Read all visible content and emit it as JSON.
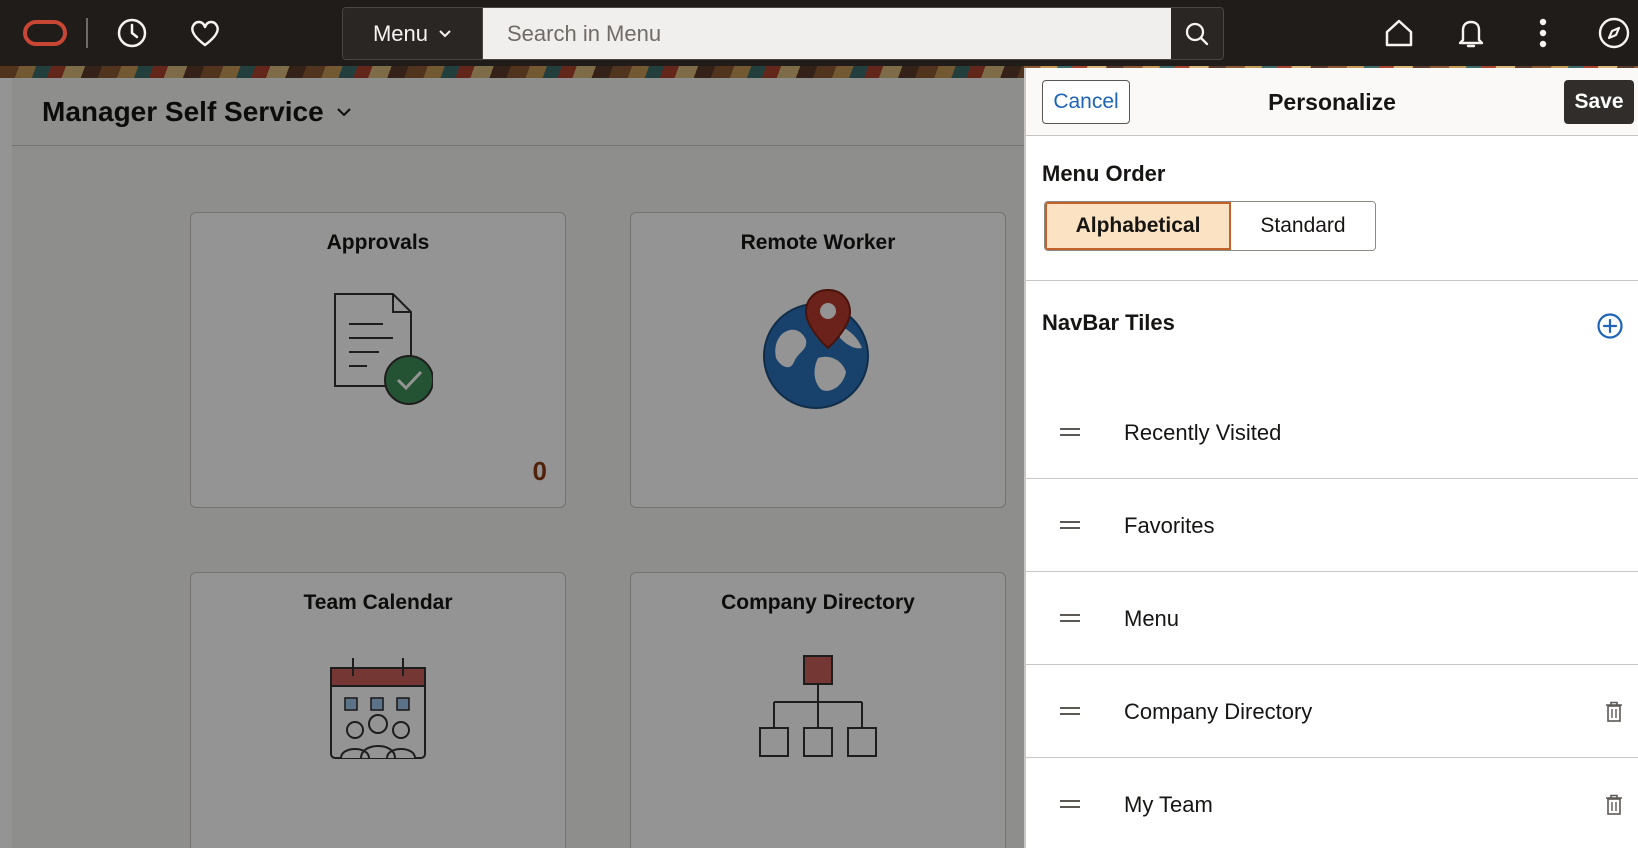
{
  "topbar": {
    "menu_label": "Menu",
    "search_placeholder": "Search in Menu",
    "icons": [
      "oracle-logo-icon",
      "clock-icon",
      "heart-icon",
      "search-icon",
      "home-icon",
      "bell-icon",
      "more-vertical-icon",
      "compass-icon"
    ]
  },
  "page": {
    "title": "Manager Self Service",
    "tiles": [
      {
        "title": "Approvals",
        "count": "0",
        "icon": "document-check-icon"
      },
      {
        "title": "Remote Worker",
        "icon": "globe-pin-icon"
      },
      {
        "title": "Team Calendar",
        "icon": "calendar-team-icon"
      },
      {
        "title": "Company Directory",
        "icon": "org-chart-icon"
      }
    ]
  },
  "panel": {
    "cancel_label": "Cancel",
    "title": "Personalize",
    "save_label": "Save",
    "menu_order_label": "Menu Order",
    "order_options": [
      "Alphabetical",
      "Standard"
    ],
    "selected_order": "Alphabetical",
    "navbar_label": "NavBar Tiles",
    "navbar_items": [
      {
        "label": "Recently Visited",
        "removable": false
      },
      {
        "label": "Favorites",
        "removable": false
      },
      {
        "label": "Menu",
        "removable": false
      },
      {
        "label": "Company Directory",
        "removable": true
      },
      {
        "label": "My Team",
        "removable": true
      }
    ]
  },
  "colors": {
    "topbar_bg": "#201c1a",
    "accent_blue": "#1d63b8",
    "selected_bg": "#fae2c3",
    "selected_border": "#c2622a",
    "count_color": "#8a3b12"
  }
}
